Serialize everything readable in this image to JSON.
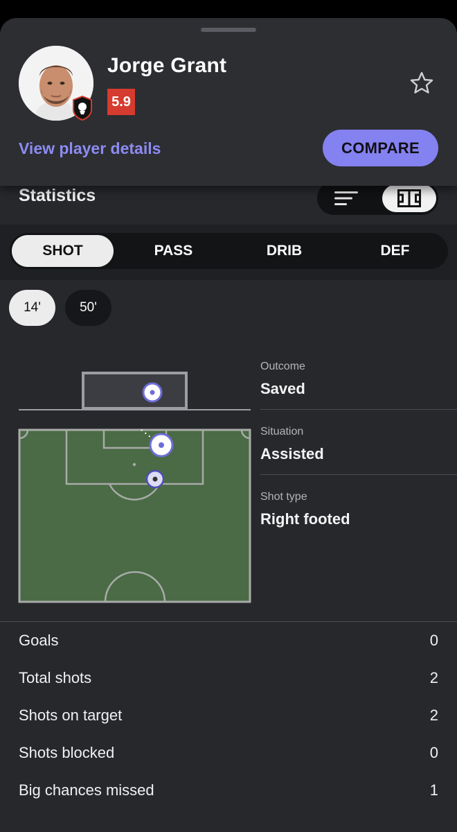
{
  "player": {
    "name": "Jorge Grant",
    "rating": "5.9",
    "view_details_label": "View player details",
    "compare_label": "COMPARE"
  },
  "colors": {
    "accent": "#8481f1",
    "rating_bg": "#d63b2f",
    "pitch_green": "#4a6b45",
    "shot_marker": "#6e6cd8"
  },
  "icons": {
    "favorite": "star-outline-icon",
    "list_view": "list-lines-icon",
    "pitch_view": "pitch-icon",
    "club": "lion-badge-icon"
  },
  "statistics": {
    "title": "Statistics"
  },
  "tabs": [
    {
      "label": "SHOT",
      "active": true
    },
    {
      "label": "PASS",
      "active": false
    },
    {
      "label": "DRIB",
      "active": false
    },
    {
      "label": "DEF",
      "active": false
    }
  ],
  "minute_chips": [
    {
      "label": "14'",
      "active": true
    },
    {
      "label": "50'",
      "active": false
    }
  ],
  "shot_details": [
    {
      "label": "Outcome",
      "value": "Saved"
    },
    {
      "label": "Situation",
      "value": "Assisted"
    },
    {
      "label": "Shot type",
      "value": "Right footed"
    }
  ],
  "summary_stats": [
    {
      "label": "Goals",
      "value": "0"
    },
    {
      "label": "Total shots",
      "value": "2"
    },
    {
      "label": "Shots on target",
      "value": "2"
    },
    {
      "label": "Shots blocked",
      "value": "0"
    },
    {
      "label": "Big chances missed",
      "value": "1"
    }
  ]
}
